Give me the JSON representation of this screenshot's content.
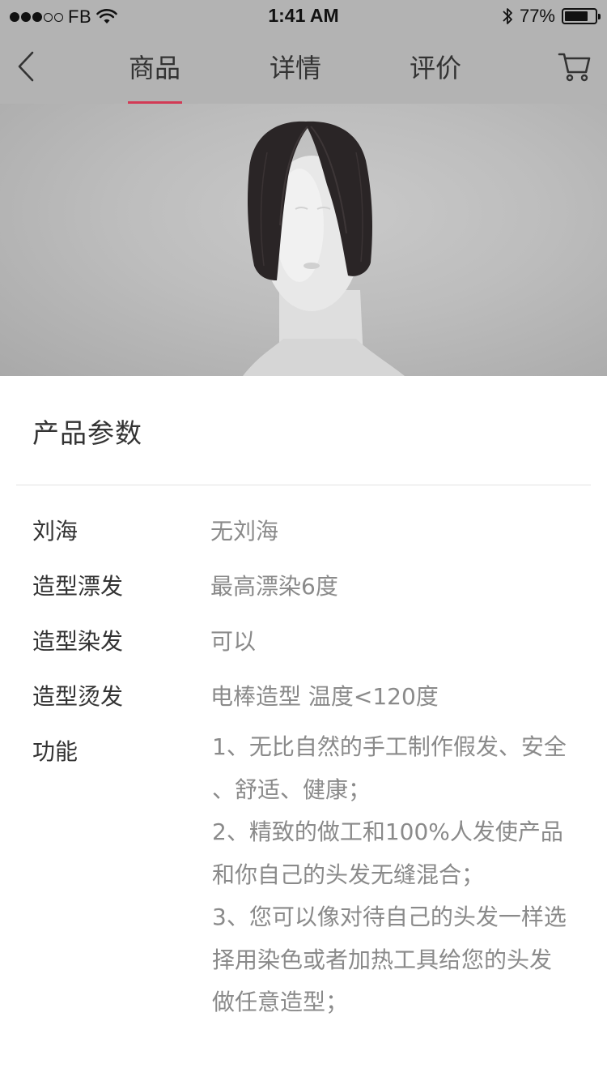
{
  "status_bar": {
    "carrier": "FB",
    "time": "1:41 AM",
    "battery_percent": "77%",
    "battery_level": 0.77,
    "signal_bars_filled": 3,
    "signal_bars_total": 5
  },
  "nav": {
    "tabs": [
      {
        "label": "商品",
        "active": true
      },
      {
        "label": "详情",
        "active": false
      },
      {
        "label": "评价",
        "active": false
      }
    ],
    "accent_color": "#d23a55",
    "back_icon": "chevron-left-icon",
    "cart_icon": "cart-icon"
  },
  "hero": {
    "image": "wig-on-mannequin"
  },
  "params": {
    "title": "产品参数",
    "rows": [
      {
        "label": "刘海",
        "value": "无刘海"
      },
      {
        "label": "造型漂发",
        "value": "最高漂染6度"
      },
      {
        "label": "造型染发",
        "value": "可以"
      },
      {
        "label": "造型烫发",
        "value": "电棒造型 温度<120度"
      }
    ],
    "function": {
      "label": "功能",
      "lines": [
        "1、无比自然的手工制作假发、安全",
        "、舒适、健康；",
        "2、精致的做工和100%人发使产品",
        "和你自己的头发无缝混合；",
        "3、您可以像对待自己的头发一样选",
        "择用染色或者加热工具给您的头发",
        "做任意造型；"
      ]
    }
  }
}
